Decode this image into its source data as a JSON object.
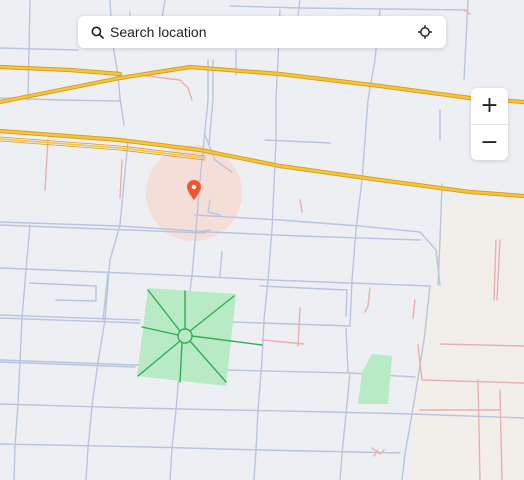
{
  "search": {
    "placeholder": "Search location"
  },
  "controls": {
    "zoom_in_label": "+",
    "zoom_out_label": "−"
  },
  "colors": {
    "map_background": "#eeeff2",
    "minor_road": "#b9c5de",
    "major_road_casing": "#d39a2a",
    "major_road_fill": "#f7c531",
    "footpath": "#e8b0b0",
    "park": "#b8ebc5",
    "park_path": "#2fae52",
    "pin": "#f2552c",
    "pin_radius_fill": "#f6d9d4",
    "residential_area": "#f2eeea"
  },
  "icons": {
    "search": "search-icon",
    "locate": "crosshair-icon",
    "pin": "location-pin-icon"
  }
}
